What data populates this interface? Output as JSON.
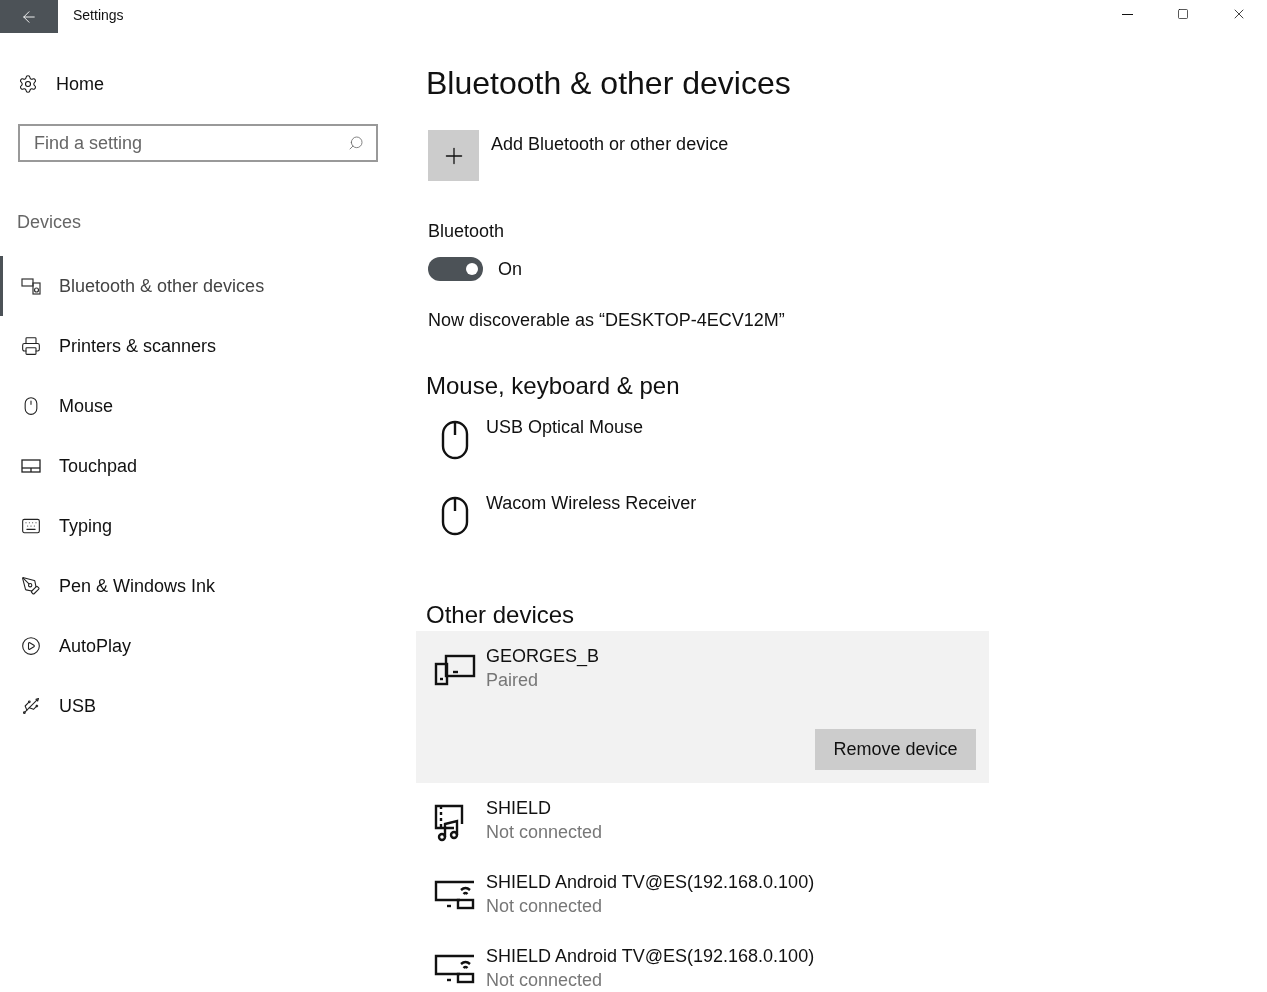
{
  "window": {
    "title": "Settings"
  },
  "sidebar": {
    "home": "Home",
    "search": {
      "placeholder": "Find a setting"
    },
    "section": "Devices",
    "items": [
      {
        "label": "Bluetooth & other devices",
        "kind": "bluetooth",
        "selected": true
      },
      {
        "label": "Printers & scanners",
        "kind": "printer",
        "selected": false
      },
      {
        "label": "Mouse",
        "kind": "mouse",
        "selected": false
      },
      {
        "label": "Touchpad",
        "kind": "touchpad",
        "selected": false
      },
      {
        "label": "Typing",
        "kind": "keyboard",
        "selected": false
      },
      {
        "label": "Pen & Windows Ink",
        "kind": "pen",
        "selected": false
      },
      {
        "label": "AutoPlay",
        "kind": "autoplay",
        "selected": false
      },
      {
        "label": "USB",
        "kind": "usb",
        "selected": false
      }
    ]
  },
  "main": {
    "title": "Bluetooth & other devices",
    "add_button": "Add Bluetooth or other device",
    "bluetooth": {
      "label": "Bluetooth",
      "on": true,
      "state_text": "On"
    },
    "discoverable": "Now discoverable as “DESKTOP-4ECV12M”",
    "sections": [
      {
        "heading": "Mouse, keyboard & pen",
        "devices": [
          {
            "name": "USB Optical Mouse",
            "kind": "mouse",
            "selected": false
          },
          {
            "name": "Wacom Wireless Receiver",
            "kind": "mouse",
            "selected": false
          }
        ]
      },
      {
        "heading": "Other devices",
        "devices": [
          {
            "name": "GEORGES_B",
            "status": "Paired",
            "kind": "phone",
            "selected": true,
            "action": "Remove device"
          },
          {
            "name": "SHIELD",
            "status": "Not connected",
            "kind": "media",
            "selected": false
          },
          {
            "name": "SHIELD Android TV@ES(192.168.0.100)",
            "status": "Not connected",
            "kind": "display",
            "selected": false
          },
          {
            "name": "SHIELD Android TV@ES(192.168.0.100)",
            "status": "Not connected",
            "kind": "display",
            "selected": false
          }
        ]
      }
    ]
  }
}
